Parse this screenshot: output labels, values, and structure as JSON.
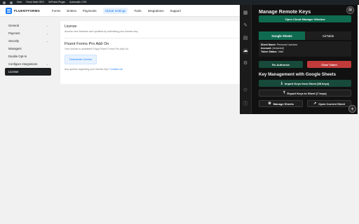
{
  "wp_admin_bar": {
    "items": [
      "New",
      "Rank Math SEO",
      "WPvivid Plugin",
      "Automatic CSS"
    ]
  },
  "ff_nav": {
    "brand": "FLUENTFORMS",
    "items": [
      "Forms",
      "Entries",
      "Payments",
      "Global Settings",
      "Tools",
      "Integrations",
      "Support"
    ],
    "active_index": 3
  },
  "sidebar": {
    "items": [
      {
        "label": "General",
        "chevron": true
      },
      {
        "label": "Payment",
        "chevron": true
      },
      {
        "label": "Security",
        "chevron": true
      },
      {
        "label": "Managers",
        "chevron": false
      },
      {
        "label": "Double Opt-In",
        "chevron": false
      },
      {
        "label": "Configure Integrations",
        "chevron": true
      },
      {
        "label": "License",
        "chevron": false
      }
    ],
    "active_index": 6
  },
  "license": {
    "title": "License",
    "subtitle": "Access new features and updates by activating your license key.",
    "pro_title": "Fluent Forms Pro Add On",
    "pro_subtitle": "Your license is activated! Enjoy Fluent Forms Pro Add On.",
    "deactivate_label": "Deactivate License",
    "contact_prefix": "Any queries regarding your license key?",
    "contact_link": "Contact us!"
  },
  "panel": {
    "title": "Manage Remote Keys",
    "open_manager_label": "Open Cloud Manager Window",
    "tabs": [
      "Google Sheets",
      "AirTable"
    ],
    "active_tab": 0,
    "sheet_name_label": "Sheet Name:",
    "sheet_name": "Personal Licenses",
    "account_label": "Account:",
    "account": "[redacted]",
    "token_status_label": "Token Status:",
    "token_status": "Valid",
    "reauthorize_label": "Re-Authorize",
    "clear_token_label": "Clear Token",
    "section_title": "Key Management with Google Sheets",
    "import_label": "Import Keys from Sheet (98 keys)",
    "export_label": "Export Keys to Sheet (7 keys)",
    "manage_sheets_label": "Manage Sheets",
    "open_current_label": "Open Current Sheet"
  },
  "colors": {
    "accent": "#1a7efb",
    "panel_green": "#0f6b4f",
    "danger": "#c23b3b"
  }
}
